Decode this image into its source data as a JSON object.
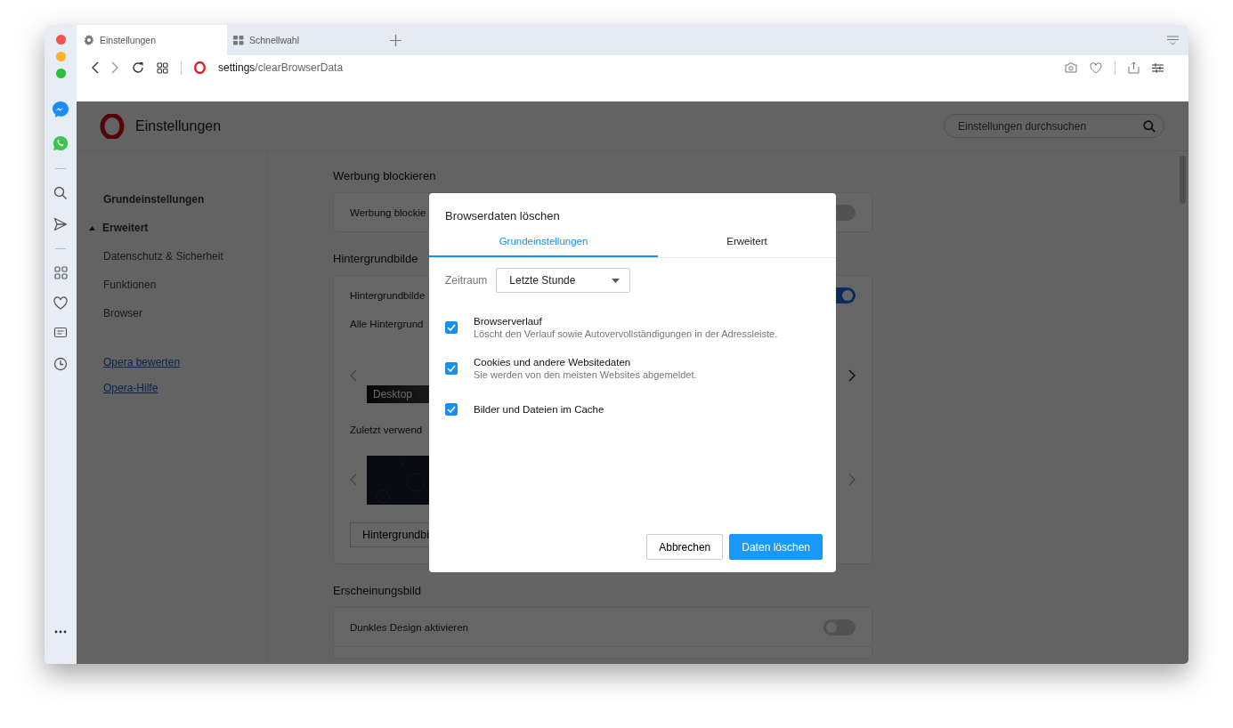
{
  "tabs": [
    {
      "label": "Einstellungen",
      "selected": true,
      "kind": "settings"
    },
    {
      "label": "Schnellwahl",
      "selected": false,
      "kind": "speed_dial"
    }
  ],
  "address_bar": {
    "scheme": "settings",
    "path": "/clearBrowserData"
  },
  "settings_header": {
    "title": "Einstellungen",
    "search_placeholder": "Einstellungen durchsuchen"
  },
  "nav": {
    "basic": "Grundeinstellungen",
    "advanced": {
      "label": "Erweitert",
      "expanded": true,
      "children": [
        "Datenschutz & Sicherheit",
        "Funktionen",
        "Browser"
      ]
    },
    "links": [
      "Opera bewerten",
      "Opera-Hilfe"
    ]
  },
  "sections": [
    {
      "title": "Werbung blockieren",
      "rows": [
        {
          "kind": "toggle",
          "label": "Werbung blockie",
          "on": false
        }
      ]
    },
    {
      "title": "Hintergrundbilde",
      "rows": [
        {
          "kind": "toggle",
          "label": "Hintergrundbilde",
          "on": true
        },
        {
          "kind": "gallery",
          "label": "Alle Hintergrund",
          "thumb_caption": "Desktop",
          "next_enabled": true
        },
        {
          "kind": "gallery",
          "label": "Zuletzt verwend",
          "next_enabled": false
        },
        {
          "kind": "button",
          "label": "Hintergrundbi"
        }
      ]
    },
    {
      "title": "Erscheinungsbild",
      "rows": [
        {
          "kind": "toggle",
          "label": "Dunkles Design aktivieren",
          "on": false
        },
        {
          "kind": "empty"
        }
      ]
    }
  ],
  "dialog": {
    "title": "Browserdaten löschen",
    "tabs": [
      {
        "label": "Grundeinstellungen",
        "selected": true
      },
      {
        "label": "Erweitert",
        "selected": false
      }
    ],
    "time_range": {
      "label": "Zeitraum",
      "value": "Letzte Stunde"
    },
    "options": [
      {
        "title": "Browserverlauf",
        "description": "Löscht den Verlauf sowie Autovervollständigungen in der Adressleiste.",
        "checked": true
      },
      {
        "title": "Cookies und andere Websitedaten",
        "description": "Sie werden von den meisten Websites abgemeldet.",
        "checked": true
      },
      {
        "title": "Bilder und Dateien im Cache",
        "checked": true
      }
    ],
    "buttons": [
      {
        "label": "Abbrechen",
        "kind": "secondary"
      },
      {
        "label": "Daten löschen",
        "kind": "primary"
      }
    ]
  }
}
